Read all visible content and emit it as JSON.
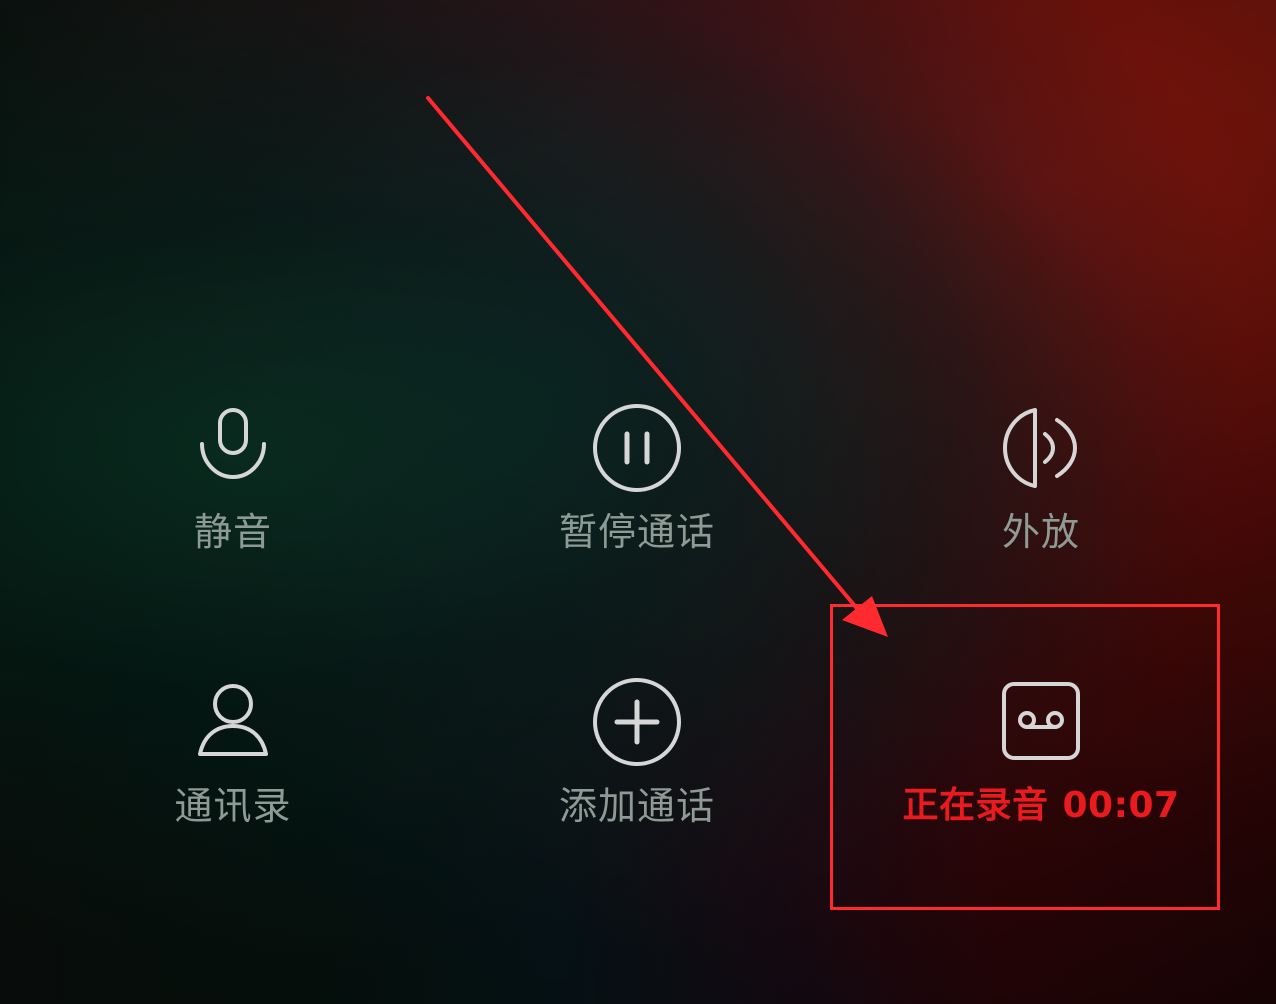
{
  "call_controls": {
    "mute": {
      "label": "静音",
      "icon": "microphone-icon"
    },
    "hold": {
      "label": "暂停通话",
      "icon": "pause-icon"
    },
    "speaker": {
      "label": "外放",
      "icon": "speaker-icon"
    },
    "contacts": {
      "label": "通讯录",
      "icon": "contact-icon"
    },
    "add_call": {
      "label": "添加通话",
      "icon": "plus-circle-icon"
    },
    "record": {
      "label": "正在录音",
      "timer": "00:07",
      "icon": "cassette-tape-icon"
    }
  },
  "colors": {
    "icon_color": "#d6d6d6",
    "label_color": "#8e9b95",
    "recording_color": "#ea1b1e",
    "annotation_color": "#ff2a2f"
  },
  "annotations": {
    "highlight_box": "highlight-box",
    "arrow": "arrow-icon"
  }
}
